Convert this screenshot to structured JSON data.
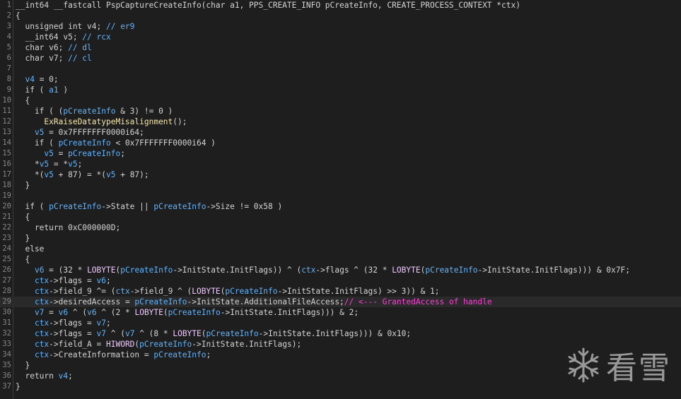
{
  "editor": {
    "current_line": 29,
    "lines": [
      {
        "n": "1",
        "tokens": [
          [
            "plain",
            "__int64 __fastcall PspCaptureCreateInfo(char a1, PPS_CREATE_INFO pCreateInfo, CREATE_PROCESS_CONTEXT *ctx)"
          ]
        ]
      },
      {
        "n": "2",
        "tokens": [
          [
            "plain",
            "{"
          ]
        ]
      },
      {
        "n": "3",
        "tokens": [
          [
            "plain",
            "  unsigned int v4; "
          ],
          [
            "cmt",
            "// er9"
          ]
        ]
      },
      {
        "n": "4",
        "tokens": [
          [
            "plain",
            "  __int64 v5; "
          ],
          [
            "cmt",
            "// rcx"
          ]
        ]
      },
      {
        "n": "5",
        "tokens": [
          [
            "plain",
            "  char v6; "
          ],
          [
            "cmt",
            "// dl"
          ]
        ]
      },
      {
        "n": "6",
        "tokens": [
          [
            "plain",
            "  char v7; "
          ],
          [
            "cmt",
            "// cl"
          ]
        ]
      },
      {
        "n": "7",
        "tokens": []
      },
      {
        "n": "8",
        "tokens": [
          [
            "plain",
            "  "
          ],
          [
            "var",
            "v4"
          ],
          [
            "plain",
            " = 0;"
          ]
        ]
      },
      {
        "n": "9",
        "tokens": [
          [
            "plain",
            "  if ( "
          ],
          [
            "var",
            "a1"
          ],
          [
            "plain",
            " )"
          ]
        ]
      },
      {
        "n": "10",
        "tokens": [
          [
            "plain",
            "  {"
          ]
        ]
      },
      {
        "n": "11",
        "tokens": [
          [
            "plain",
            "    if ( ("
          ],
          [
            "var",
            "pCreateInfo"
          ],
          [
            "plain",
            " & 3) != 0 )"
          ]
        ]
      },
      {
        "n": "12",
        "tokens": [
          [
            "plain",
            "      "
          ],
          [
            "fn",
            "ExRaiseDatatypeMisalignment"
          ],
          [
            "plain",
            "();"
          ]
        ]
      },
      {
        "n": "13",
        "tokens": [
          [
            "plain",
            "    "
          ],
          [
            "var",
            "v5"
          ],
          [
            "plain",
            " = 0x7FFFFFFF0000i64;"
          ]
        ]
      },
      {
        "n": "14",
        "tokens": [
          [
            "plain",
            "    if ( "
          ],
          [
            "var",
            "pCreateInfo"
          ],
          [
            "plain",
            " < 0x7FFFFFFF0000i64 )"
          ]
        ]
      },
      {
        "n": "15",
        "tokens": [
          [
            "plain",
            "      "
          ],
          [
            "var",
            "v5"
          ],
          [
            "plain",
            " = "
          ],
          [
            "var",
            "pCreateInfo"
          ],
          [
            "plain",
            ";"
          ]
        ]
      },
      {
        "n": "16",
        "tokens": [
          [
            "plain",
            "    *"
          ],
          [
            "var",
            "v5"
          ],
          [
            "plain",
            " = *"
          ],
          [
            "var",
            "v5"
          ],
          [
            "plain",
            ";"
          ]
        ]
      },
      {
        "n": "17",
        "tokens": [
          [
            "plain",
            "    *("
          ],
          [
            "var",
            "v5"
          ],
          [
            "plain",
            " + 87) = *("
          ],
          [
            "var",
            "v5"
          ],
          [
            "plain",
            " + 87);"
          ]
        ]
      },
      {
        "n": "18",
        "tokens": [
          [
            "plain",
            "  }"
          ]
        ]
      },
      {
        "n": "19",
        "tokens": []
      },
      {
        "n": "20",
        "tokens": [
          [
            "plain",
            "  if ( "
          ],
          [
            "var",
            "pCreateInfo"
          ],
          [
            "plain",
            "->State || "
          ],
          [
            "var",
            "pCreateInfo"
          ],
          [
            "plain",
            "->Size != 0x58 )"
          ]
        ]
      },
      {
        "n": "21",
        "tokens": [
          [
            "plain",
            "  {"
          ]
        ]
      },
      {
        "n": "22",
        "tokens": [
          [
            "plain",
            "    return 0xC000000D;"
          ]
        ]
      },
      {
        "n": "23",
        "tokens": [
          [
            "plain",
            "  }"
          ]
        ]
      },
      {
        "n": "24",
        "tokens": [
          [
            "plain",
            "  else"
          ]
        ]
      },
      {
        "n": "25",
        "tokens": [
          [
            "plain",
            "  {"
          ]
        ]
      },
      {
        "n": "26",
        "tokens": [
          [
            "plain",
            "    "
          ],
          [
            "var",
            "v6"
          ],
          [
            "plain",
            " = (32 * "
          ],
          [
            "macro",
            "LOBYTE"
          ],
          [
            "plain",
            "("
          ],
          [
            "var",
            "pCreateInfo"
          ],
          [
            "plain",
            "->InitState.InitFlags)) ^ ("
          ],
          [
            "var",
            "ctx"
          ],
          [
            "plain",
            "->flags ^ (32 * "
          ],
          [
            "macro",
            "LOBYTE"
          ],
          [
            "plain",
            "("
          ],
          [
            "var",
            "pCreateInfo"
          ],
          [
            "plain",
            "->InitState.InitFlags))) & 0x7F;"
          ]
        ]
      },
      {
        "n": "27",
        "tokens": [
          [
            "plain",
            "    "
          ],
          [
            "var",
            "ctx"
          ],
          [
            "plain",
            "->flags = "
          ],
          [
            "var",
            "v6"
          ],
          [
            "plain",
            ";"
          ]
        ]
      },
      {
        "n": "28",
        "tokens": [
          [
            "plain",
            "    "
          ],
          [
            "var",
            "ctx"
          ],
          [
            "plain",
            "->field_9 ^= ("
          ],
          [
            "var",
            "ctx"
          ],
          [
            "plain",
            "->field_9 ^ ("
          ],
          [
            "macro",
            "LOBYTE"
          ],
          [
            "plain",
            "("
          ],
          [
            "var",
            "pCreateInfo"
          ],
          [
            "plain",
            "->InitState.InitFlags) >> 3)) & 1;"
          ]
        ]
      },
      {
        "n": "29",
        "tokens": [
          [
            "plain",
            "    "
          ],
          [
            "var",
            "ctx"
          ],
          [
            "plain",
            "->desiredAccess = "
          ],
          [
            "var",
            "pCreateInfo"
          ],
          [
            "plain",
            "->InitState.AdditionalFileAccess;"
          ],
          [
            "hl",
            "// <--- GrantedAccess of handle"
          ]
        ]
      },
      {
        "n": "30",
        "tokens": [
          [
            "plain",
            "    "
          ],
          [
            "var",
            "v7"
          ],
          [
            "plain",
            " = "
          ],
          [
            "var",
            "v6"
          ],
          [
            "plain",
            " ^ ("
          ],
          [
            "var",
            "v6"
          ],
          [
            "plain",
            " ^ (2 * "
          ],
          [
            "macro",
            "LOBYTE"
          ],
          [
            "plain",
            "("
          ],
          [
            "var",
            "pCreateInfo"
          ],
          [
            "plain",
            "->InitState.InitFlags))) & 2;"
          ]
        ]
      },
      {
        "n": "31",
        "tokens": [
          [
            "plain",
            "    "
          ],
          [
            "var",
            "ctx"
          ],
          [
            "plain",
            "->flags = "
          ],
          [
            "var",
            "v7"
          ],
          [
            "plain",
            ";"
          ]
        ]
      },
      {
        "n": "32",
        "tokens": [
          [
            "plain",
            "    "
          ],
          [
            "var",
            "ctx"
          ],
          [
            "plain",
            "->flags = "
          ],
          [
            "var",
            "v7"
          ],
          [
            "plain",
            " ^ ("
          ],
          [
            "var",
            "v7"
          ],
          [
            "plain",
            " ^ (8 * "
          ],
          [
            "macro",
            "LOBYTE"
          ],
          [
            "plain",
            "("
          ],
          [
            "var",
            "pCreateInfo"
          ],
          [
            "plain",
            "->InitState.InitFlags))) & 0x10;"
          ]
        ]
      },
      {
        "n": "33",
        "tokens": [
          [
            "plain",
            "    "
          ],
          [
            "var",
            "ctx"
          ],
          [
            "plain",
            "->field_A = "
          ],
          [
            "macro",
            "HIWORD"
          ],
          [
            "plain",
            "("
          ],
          [
            "var",
            "pCreateInfo"
          ],
          [
            "plain",
            "->InitState.InitFlags);"
          ]
        ]
      },
      {
        "n": "34",
        "tokens": [
          [
            "plain",
            "    "
          ],
          [
            "var",
            "ctx"
          ],
          [
            "plain",
            "->CreateInformation = "
          ],
          [
            "var",
            "pCreateInfo"
          ],
          [
            "plain",
            ";"
          ]
        ]
      },
      {
        "n": "35",
        "tokens": [
          [
            "plain",
            "  }"
          ]
        ]
      },
      {
        "n": "36",
        "tokens": [
          [
            "plain",
            "  return "
          ],
          [
            "var",
            "v4"
          ],
          [
            "plain",
            ";"
          ]
        ]
      },
      {
        "n": "37",
        "tokens": [
          [
            "plain",
            "}"
          ]
        ]
      }
    ]
  },
  "watermark": {
    "text": "看雪",
    "icon": "snowflake-icon",
    "color": "#ffffff"
  },
  "colors": {
    "background": "#1e1e1e",
    "plain": "#d4d4d4",
    "variable": "#5eb4ff",
    "highlight_comment": "#ff3fd8",
    "macro": "#f0c8ff"
  }
}
